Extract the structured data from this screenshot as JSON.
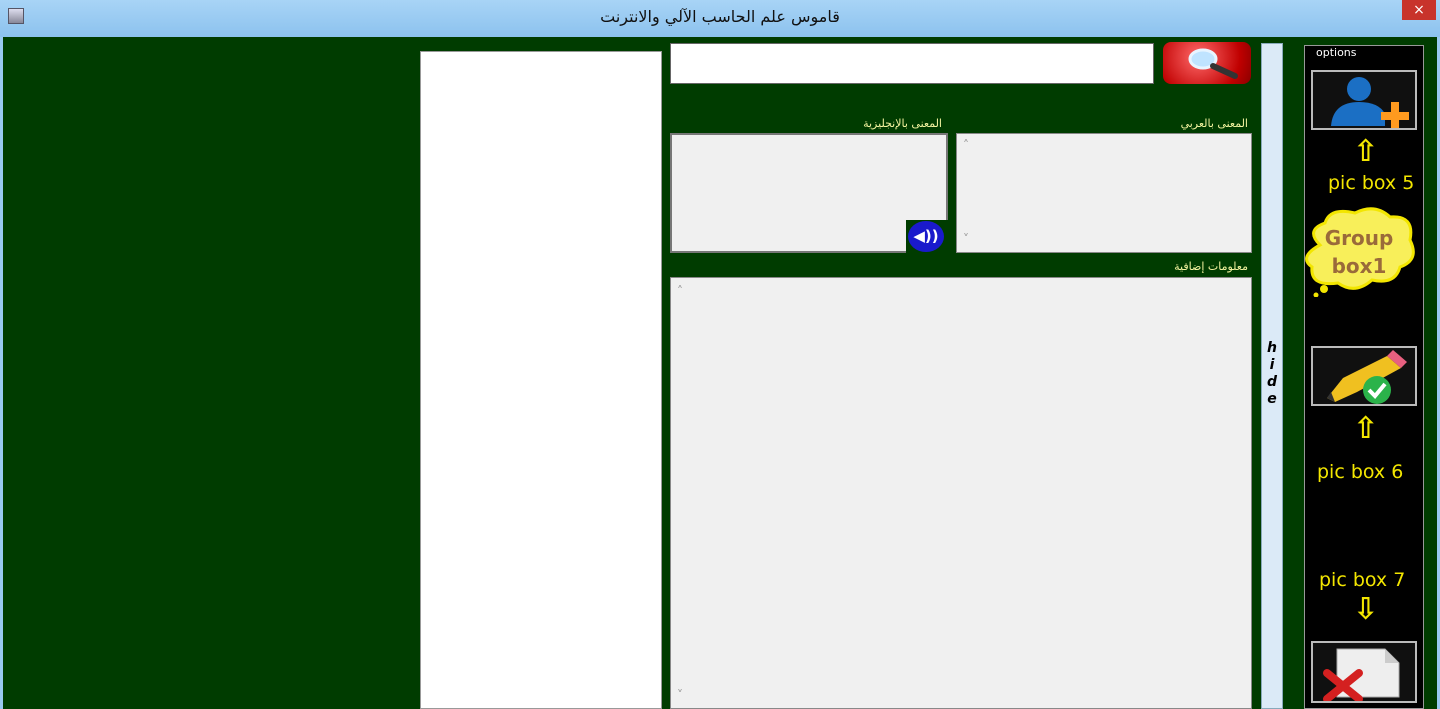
{
  "window": {
    "title": "قاموس علم الحاسب الآلي والانترنت",
    "close_label": "×"
  },
  "search": {
    "value": "",
    "placeholder": ""
  },
  "labels": {
    "english_meaning": "المعنى بالإنجليزية",
    "arabic_meaning": "المعنى بالعربي",
    "extra_info": "معلومات إضافية"
  },
  "hide_label": "h i d e",
  "options": {
    "group_label": "options",
    "buttons": [
      {
        "name": "add-word",
        "icon": "user-add-icon"
      },
      {
        "name": "edit-word",
        "icon": "pencil-check-icon"
      },
      {
        "name": "delete-word",
        "icon": "document-delete-icon"
      }
    ]
  },
  "annotations": {
    "pic5": "pic box 5",
    "group": "Group box1",
    "pic6": "pic box 6",
    "pic7": "pic box 7"
  },
  "colors": {
    "background": "#003c00",
    "accent": "#f3e600",
    "title_bar": "#99c9f0",
    "close": "#c8332b"
  }
}
